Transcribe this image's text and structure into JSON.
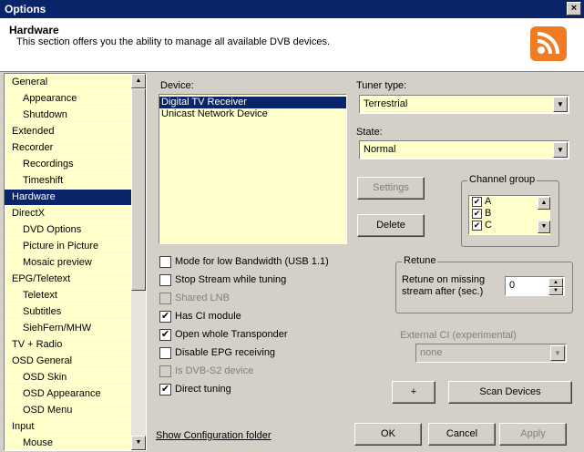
{
  "window": {
    "title": "Options",
    "close": "×"
  },
  "header": {
    "title": "Hardware",
    "description": "This section offers you the ability to manage all available DVB devices.",
    "logo": "rss-icon",
    "logo_color": "#ef7b22"
  },
  "nav": {
    "items": [
      {
        "label": "General",
        "level": 0
      },
      {
        "label": "Appearance",
        "level": 1
      },
      {
        "label": "Shutdown",
        "level": 1
      },
      {
        "label": "Extended",
        "level": 0
      },
      {
        "label": "Recorder",
        "level": 0
      },
      {
        "label": "Recordings",
        "level": 1
      },
      {
        "label": "Timeshift",
        "level": 1
      },
      {
        "label": "Hardware",
        "level": 0,
        "selected": true
      },
      {
        "label": "DirectX",
        "level": 0
      },
      {
        "label": "DVD Options",
        "level": 1
      },
      {
        "label": "Picture in Picture",
        "level": 1
      },
      {
        "label": "Mosaic preview",
        "level": 1
      },
      {
        "label": "EPG/Teletext",
        "level": 0
      },
      {
        "label": "Teletext",
        "level": 1
      },
      {
        "label": "Subtitles",
        "level": 1
      },
      {
        "label": "SiehFern/MHW",
        "level": 1
      },
      {
        "label": "TV + Radio",
        "level": 0
      },
      {
        "label": "OSD General",
        "level": 0
      },
      {
        "label": "OSD Skin",
        "level": 1
      },
      {
        "label": "OSD Appearance",
        "level": 1
      },
      {
        "label": "OSD Menu",
        "level": 1
      },
      {
        "label": "Input",
        "level": 0
      },
      {
        "label": "Mouse",
        "level": 1
      }
    ]
  },
  "device": {
    "label": "Device:",
    "items": [
      "Digital TV Receiver",
      "Unicast Network Device"
    ],
    "selected": 0
  },
  "tuner": {
    "label": "Tuner type:",
    "value": "Terrestrial"
  },
  "state": {
    "label": "State:",
    "value": "Normal"
  },
  "buttons": {
    "settings": "Settings",
    "delete": "Delete",
    "plus": "+",
    "scan": "Scan Devices",
    "ok": "OK",
    "cancel": "Cancel",
    "apply": "Apply"
  },
  "channel_group": {
    "title": "Channel group",
    "items": [
      {
        "label": "A",
        "checked": true
      },
      {
        "label": "B",
        "checked": true
      },
      {
        "label": "C",
        "checked": true
      }
    ]
  },
  "options": [
    {
      "label": "Mode for low Bandwidth (USB 1.1)",
      "checked": false,
      "enabled": true
    },
    {
      "label": "Stop Stream while tuning",
      "checked": false,
      "enabled": true
    },
    {
      "label": "Shared LNB",
      "checked": false,
      "enabled": false
    },
    {
      "label": "Has CI module",
      "checked": true,
      "enabled": true
    },
    {
      "label": "Open whole Transponder",
      "checked": true,
      "enabled": true
    },
    {
      "label": "Disable EPG receiving",
      "checked": false,
      "enabled": true
    },
    {
      "label": "Is DVB-S2 device",
      "checked": false,
      "enabled": false
    },
    {
      "label": "Direct tuning",
      "checked": true,
      "enabled": true
    }
  ],
  "retune": {
    "title": "Retune",
    "label_line1": "Retune on missing",
    "label_line2": "stream after (sec.)",
    "value": "0"
  },
  "external_ci": {
    "label": "External CI (experimental)",
    "value": "none"
  },
  "footer": {
    "link": "Show Configuration folder"
  }
}
